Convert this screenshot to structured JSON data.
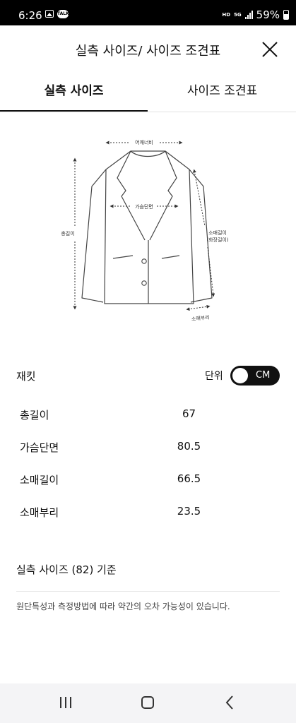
{
  "status_bar": {
    "time": "6:26",
    "talk_badge": "TALK",
    "network": "HD",
    "network2": "5G",
    "battery": "59%"
  },
  "header": {
    "title": "실측 사이즈/ 사이즈 조견표"
  },
  "tabs": [
    {
      "label": "실측 사이즈",
      "active": true
    },
    {
      "label": "사이즈 조견표",
      "active": false
    }
  ],
  "diagram": {
    "shoulder": "어깨너비",
    "chest": "가슴단면",
    "total_length": "총길이",
    "sleeve_length": "소매길이",
    "sleeve_length_sub": "(화장길이)",
    "sleeve_opening": "소매부리"
  },
  "item": {
    "name": "재킷",
    "unit_label": "단위",
    "unit_value": "CM"
  },
  "measurements": [
    {
      "label": "총길이",
      "value": "67"
    },
    {
      "label": "가슴단면",
      "value": "80.5"
    },
    {
      "label": "소매길이",
      "value": "66.5"
    },
    {
      "label": "소매부리",
      "value": "23.5"
    }
  ],
  "footer": {
    "basis": "실측 사이즈 (82) 기준",
    "note": "원단특성과 측정방법에 따라 약간의 오차 가능성이 있습니다."
  },
  "colors": {
    "text": "#111111",
    "toggle_bg": "#111111",
    "divider": "#e2e2e2",
    "navbar_bg": "#f4f4f6"
  }
}
